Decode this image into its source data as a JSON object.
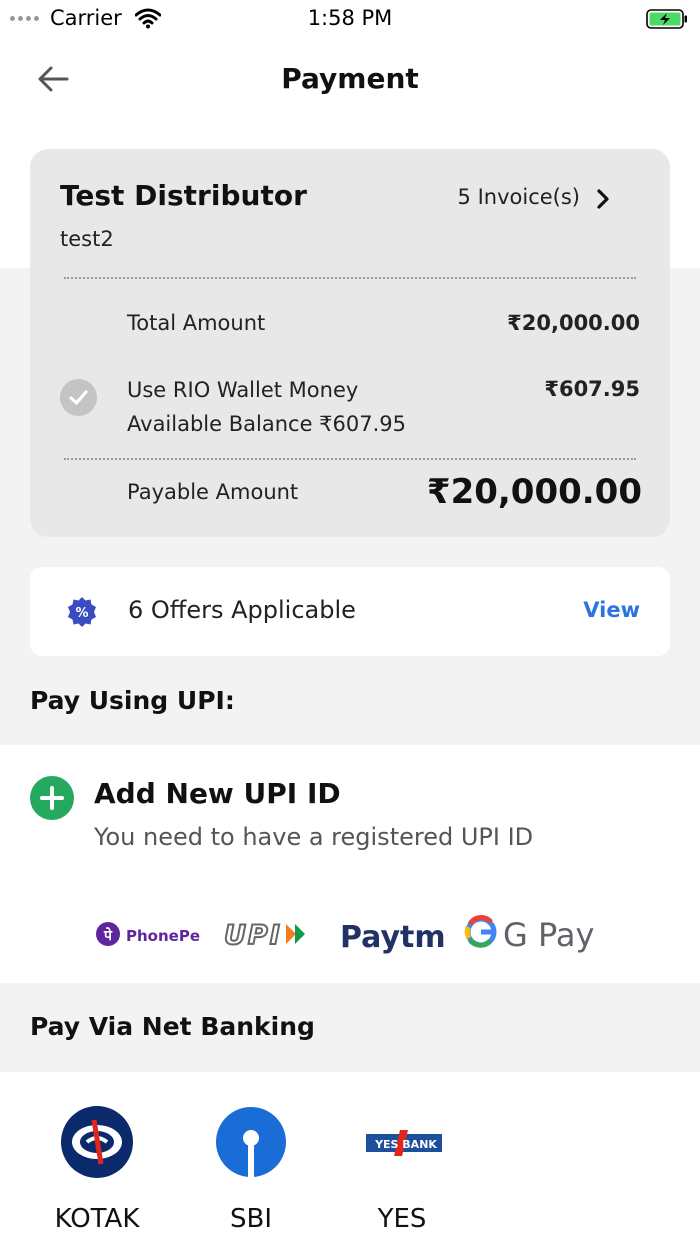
{
  "status_bar": {
    "carrier": "Carrier",
    "time": "1:58 PM"
  },
  "header": {
    "title": "Payment"
  },
  "summary": {
    "distributor_name": "Test Distributor",
    "distributor_sub": "test2",
    "invoices": "5 Invoice(s)",
    "total_label": "Total Amount",
    "total_value": "₹20,000.00",
    "wallet_label": "Use RIO Wallet Money",
    "wallet_balance": "Available Balance ₹607.95",
    "wallet_value": "₹607.95",
    "payable_label": "Payable Amount",
    "payable_value": "₹20,000.00"
  },
  "offers": {
    "text": "6 Offers Applicable",
    "action": "View"
  },
  "upi": {
    "section_title": "Pay Using UPI:",
    "add_title": "Add New UPI ID",
    "add_subtitle": "You need to have a registered UPI ID",
    "apps": [
      "PhonePe",
      "UPI",
      "Paytm",
      "G Pay"
    ]
  },
  "net_banking": {
    "section_title": "Pay Via Net Banking",
    "banks": [
      {
        "name": "KOTAK"
      },
      {
        "name": "SBI"
      },
      {
        "name": "YES",
        "logo_text": "YES BANK"
      }
    ]
  },
  "colors": {
    "accent_blue": "#2a73e0",
    "plus_green": "#24a95f",
    "card_gray": "#e8e8e8"
  }
}
